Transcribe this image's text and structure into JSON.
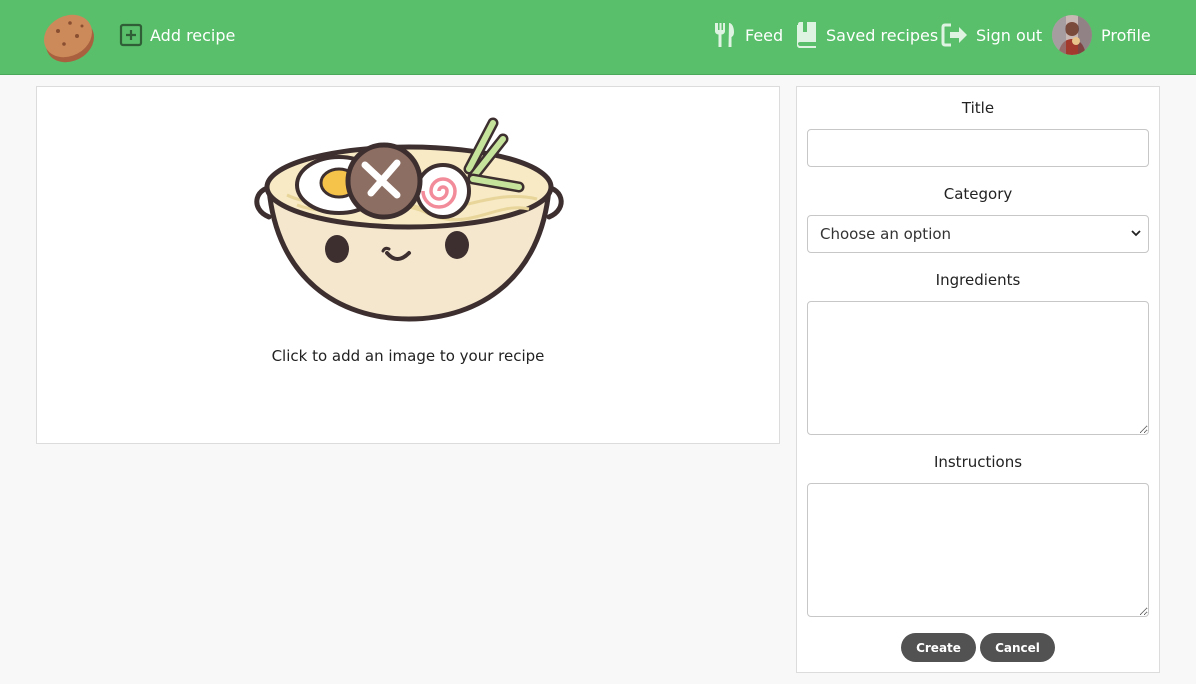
{
  "nav": {
    "logo_icon": "potato-logo-icon",
    "add_recipe": "Add recipe",
    "feed": "Feed",
    "saved_recipes": "Saved recipes",
    "sign_out": "Sign out",
    "profile": "Profile",
    "brand_color": "#59bf6a"
  },
  "image_upload": {
    "placeholder_icon": "ramen-bowl-illustration",
    "caption": "Click to add an image to your recipe"
  },
  "form": {
    "title_label": "Title",
    "title_value": "",
    "category_label": "Category",
    "category_selected": "Choose an option",
    "ingredients_label": "Ingredients",
    "ingredients_value": "",
    "instructions_label": "Instructions",
    "instructions_value": "",
    "create_label": "Create",
    "cancel_label": "Cancel",
    "button_color": "#525252"
  }
}
